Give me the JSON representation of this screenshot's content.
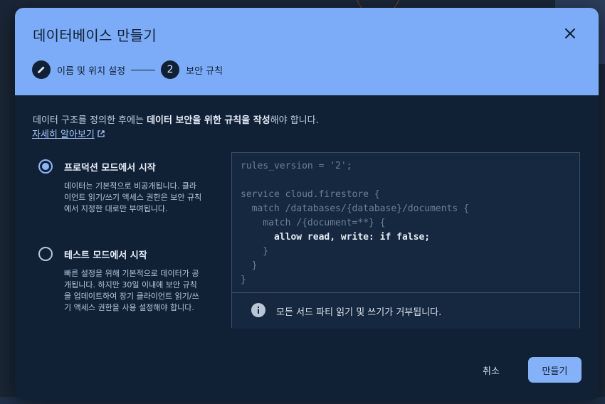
{
  "dialog": {
    "title": "데이터베이스 만들기",
    "close_icon": "close-icon"
  },
  "stepper": {
    "steps": [
      {
        "indicator": "edit-icon",
        "label": "이름 및 위치 설정"
      },
      {
        "indicator": "2",
        "label": "보안 규칙"
      }
    ]
  },
  "intro": {
    "text_before": "데이터 구조를 정의한 후에는 ",
    "text_bold": "데이터 보안을 위한 규칙을 작성",
    "text_after": "해야 합니다.",
    "learn_more": "자세히 알아보기",
    "learn_more_icon": "external-link-icon"
  },
  "options": [
    {
      "label": "프로덕션 모드에서 시작",
      "description": "데이터는 기본적으로 비공개됩니다. 클라이언트 읽기/쓰기 액세스 권한은 보안 규칙에서 지정한 대로만 부여됩니다.",
      "selected": true
    },
    {
      "label": "테스트 모드에서 시작",
      "description": "빠른 설정을 위해 기본적으로 데이터가 공개됩니다. 하지만 30일 이내에 보안 규칙을 업데이트하여 장기 클라이언트 읽기/쓰기 액세스 권한을 사용 설정해야 합니다.",
      "selected": false
    }
  ],
  "rules": {
    "lines": [
      "rules_version = '2';",
      "",
      "service cloud.firestore {",
      "  match /databases/{database}/documents {",
      "    match /{document=**} {",
      "      allow read, write: if false;",
      "    }",
      "  }",
      "}"
    ],
    "highlight_line": 5,
    "info_icon": "info-icon",
    "info_text": "모든 서드 파티 읽기 및 쓰기가 거부됩니다."
  },
  "actions": {
    "cancel_label": "취소",
    "create_label": "만들기"
  },
  "colors": {
    "header_bg": "#7cabf7",
    "dialog_bg": "#102136",
    "accent": "#8db4f6",
    "primary_button": "#84b1f8"
  }
}
